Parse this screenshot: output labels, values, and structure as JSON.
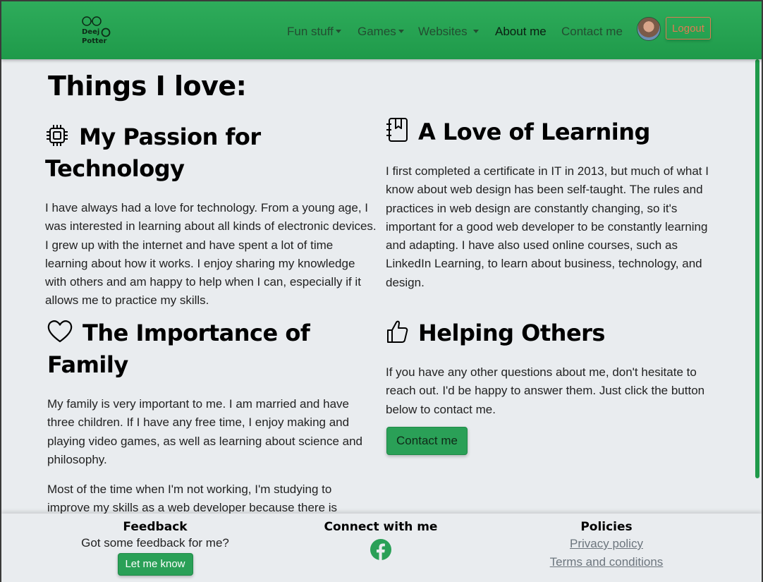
{
  "nav": {
    "logo": {
      "line1": "Deej",
      "line2": "Potter"
    },
    "items": [
      {
        "label": "Fun stuff",
        "dropdown": true
      },
      {
        "label": "Games",
        "dropdown": true
      },
      {
        "label": "Websites",
        "dropdown": true
      },
      {
        "label": "About me",
        "dropdown": false,
        "active": true
      },
      {
        "label": "Contact me",
        "dropdown": false
      }
    ],
    "logout_label": "Logout"
  },
  "main": {
    "title": "Things I love:",
    "sections": [
      {
        "icon": "cpu-chip-icon",
        "heading": "My Passion for Technology",
        "paragraphs": [
          "I have always had a love for technology. From a young age, I was interested in learning about all kinds of electronic devices. I grew up with the internet and have spent a lot of time learning about how it works. I enjoy sharing my knowledge with others and am happy to help when I can, especially if it allows me to practice my skills."
        ]
      },
      {
        "icon": "journal-bookmark-icon",
        "heading": "A Love of Learning",
        "paragraphs": [
          "I first completed a certificate in IT in 2013, but much of what I know about web design has been self-taught. The rules and practices in web design are constantly changing, so it's important for a good web developer to be constantly learning and adapting. I have also used online courses, such as LinkedIn Learning, to learn about business, technology, and design."
        ]
      },
      {
        "icon": "heart-icon",
        "heading": "The Importance of Family",
        "paragraphs": [
          "My family is very important to me. I am married and have three children. If I have any free time, I enjoy making and playing video games, as well as learning about science and philosophy.",
          "Most of the time when I'm not working, I'm studying to improve my skills as a web developer because there is"
        ]
      },
      {
        "icon": "hand-thumbs-up-icon",
        "heading": "Helping Others",
        "paragraphs": [
          "If you have any other questions about me, don't hesitate to reach out. I'd be happy to answer them. Just click the button below to contact me."
        ],
        "button_label": "Contact me"
      }
    ]
  },
  "footer": {
    "feedback": {
      "heading": "Feedback",
      "text": "Got some feedback for me?",
      "button_label": "Let me know"
    },
    "connect": {
      "heading": "Connect with me",
      "icon": "facebook-icon"
    },
    "policies": {
      "heading": "Policies",
      "links": [
        "Privacy policy",
        "Terms and conditions"
      ]
    }
  },
  "colors": {
    "brand_green": "#2aa057",
    "logout_accent": "#e07a52",
    "page_bg": "#e9ecef"
  }
}
